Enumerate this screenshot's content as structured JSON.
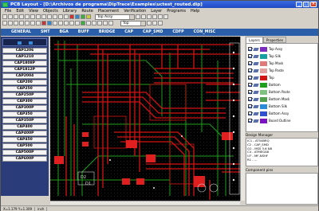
{
  "window": {
    "title": "PCB Layout - [D:\\Archivos de programa\\DipTrace\\Examples\\uctest_routed.dip]"
  },
  "menu": [
    "File",
    "Edit",
    "View",
    "Objects",
    "Library",
    "Route",
    "Placement",
    "Verification",
    "Layer",
    "Programs",
    "Help"
  ],
  "toolbar": {
    "layer_combo": "Top Assy",
    "layer_combo2": "Top"
  },
  "category_tabs": [
    "GENERAL",
    "SMT",
    "BGA",
    "BUFF",
    "BRIDGE",
    "CAP",
    "CAP_SMD",
    "CDFP",
    "CON_MISC"
  ],
  "components": [
    "CAP1206",
    "CAP1210",
    "CAP1808P",
    "CAP1812P",
    "CAP2004",
    "CAP200",
    "CAP250",
    "CAP250P",
    "CAP300",
    "CAP300P",
    "CAP350",
    "CAP350P",
    "CAP400",
    "CAP400P",
    "CAP450",
    "CAP500",
    "CAP500P",
    "CAP600P"
  ],
  "right_tabs": [
    "Layers",
    "Properties"
  ],
  "layers": [
    {
      "name": "Top Assy",
      "color": "#7b2ec0"
    },
    {
      "name": "Top Silk",
      "color": "#14a0a0"
    },
    {
      "name": "Top Mask",
      "color": "#e07a7a"
    },
    {
      "name": "Top Paste",
      "color": "#e0a0a0"
    },
    {
      "name": "Top",
      "color": "#d21414"
    },
    {
      "name": "Bottom",
      "color": "#1ea01e"
    },
    {
      "name": "Bottom Paste",
      "color": "#80c080"
    },
    {
      "name": "Bottom Mask",
      "color": "#50a050"
    },
    {
      "name": "Bottom Silk",
      "color": "#2a8cd8"
    },
    {
      "name": "Bottom Assy",
      "color": "#3050d0"
    },
    {
      "name": "Board Outline",
      "color": "#7a14c0"
    }
  ],
  "design_manager": {
    "title": "Design Manager",
    "items": [
      "IC1 - AT54BRQ",
      "C2 - CAP_SMD",
      "Q1 - MSS 3.6 N8",
      "C4 - ATMEGA8",
      "U7 - MF-NSHF",
      "R1 - ..."
    ]
  },
  "component_pins": {
    "title": "Component pins"
  },
  "status": {
    "coords": "X=1.179  Y=1.309",
    "units": "inch"
  }
}
